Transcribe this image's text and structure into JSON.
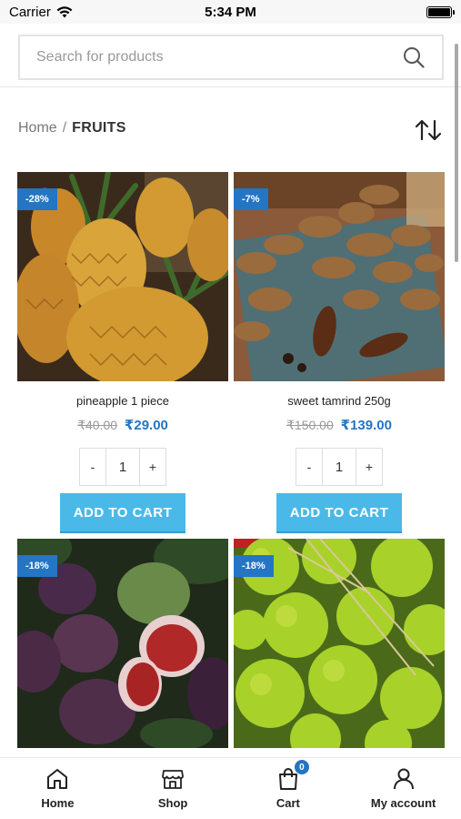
{
  "status_bar": {
    "carrier": "Carrier",
    "time": "5:34 PM"
  },
  "search": {
    "placeholder": "Search for products"
  },
  "breadcrumb": {
    "home": "Home",
    "separator": "/",
    "current": "FRUITS"
  },
  "products": [
    {
      "name": "pineapple 1 piece",
      "discount": "-28%",
      "old_price": "₹40.00",
      "price": "₹29.00",
      "qty": "1",
      "minus": "-",
      "plus": "+",
      "cta": "ADD TO CART"
    },
    {
      "name": "sweet tamrind 250g",
      "discount": "-7%",
      "old_price": "₹150.00",
      "price": "₹139.00",
      "qty": "1",
      "minus": "-",
      "plus": "+",
      "cta": "ADD TO CART"
    },
    {
      "discount": "-18%"
    },
    {
      "discount": "-18%"
    }
  ],
  "bottom_nav": {
    "home": "Home",
    "shop": "Shop",
    "cart": "Cart",
    "cart_count": "0",
    "account": "My account"
  },
  "colors": {
    "accent": "#2475c4",
    "button": "#4bb9e8"
  },
  "icons": [
    "wifi-icon",
    "battery-icon",
    "search-icon",
    "sort-icon",
    "home-icon",
    "shop-icon",
    "cart-icon",
    "user-icon"
  ]
}
